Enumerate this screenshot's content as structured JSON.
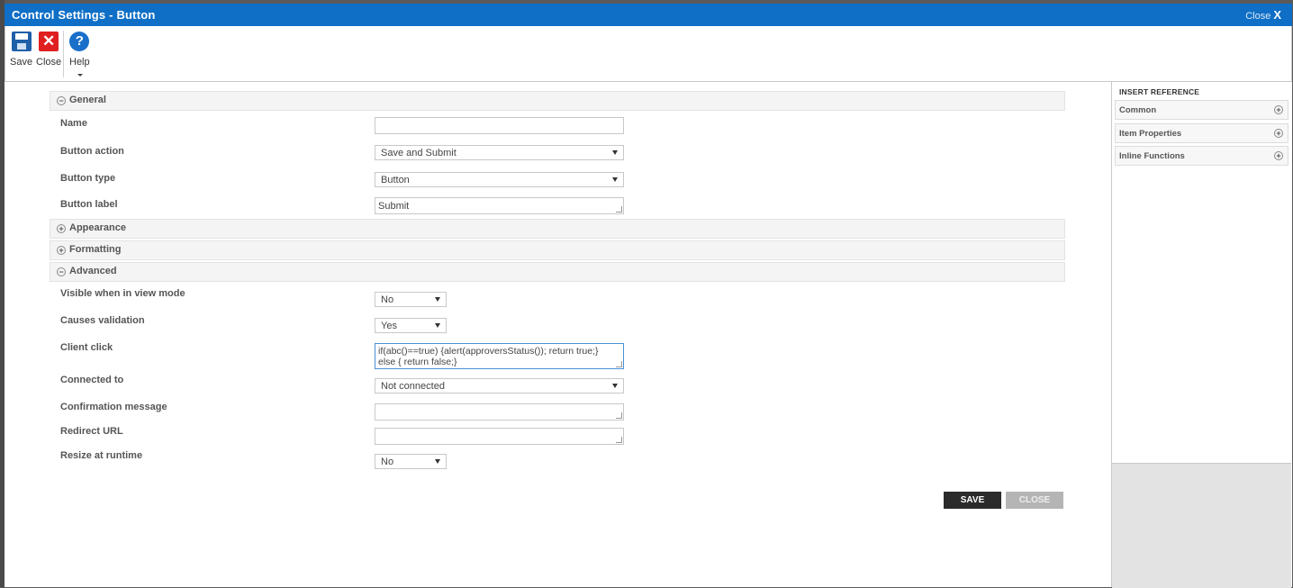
{
  "window": {
    "title": "Control Settings - Button",
    "close_label": "Close",
    "close_glyph": "X"
  },
  "ribbon": {
    "save_label": "Save",
    "close_label": "Close",
    "help_label": "Help",
    "close_glyph": "✕",
    "help_glyph": "?"
  },
  "sections": {
    "general": {
      "label": "General",
      "toggle": "−",
      "expanded": true
    },
    "appearance": {
      "label": "Appearance",
      "toggle": "+",
      "expanded": false
    },
    "formatting": {
      "label": "Formatting",
      "toggle": "+",
      "expanded": false
    },
    "advanced": {
      "label": "Advanced",
      "toggle": "−",
      "expanded": true
    }
  },
  "general": {
    "name": {
      "label": "Name",
      "value": ""
    },
    "button_action": {
      "label": "Button action",
      "value": "Save and Submit"
    },
    "button_type": {
      "label": "Button type",
      "value": "Button"
    },
    "button_label": {
      "label": "Button label",
      "value": "Submit"
    }
  },
  "advanced": {
    "visible_view_mode": {
      "label": "Visible when in view mode",
      "value": "No"
    },
    "causes_validation": {
      "label": "Causes validation",
      "value": "Yes"
    },
    "client_click": {
      "label": "Client click",
      "value": "if(abc()==true) {alert(approversStatus()); return true;} else { return false;}"
    },
    "connected_to": {
      "label": "Connected to",
      "value": "Not connected"
    },
    "confirmation_message": {
      "label": "Confirmation message",
      "value": ""
    },
    "redirect_url": {
      "label": "Redirect URL",
      "value": ""
    },
    "resize_runtime": {
      "label": "Resize at runtime",
      "value": "No"
    }
  },
  "footer": {
    "save_label": "SAVE",
    "close_label": "CLOSE"
  },
  "insert_reference": {
    "title": "INSERT REFERENCE",
    "items": [
      {
        "label": "Common",
        "toggle": "+"
      },
      {
        "label": "Item Properties",
        "toggle": "+"
      },
      {
        "label": "Inline Functions",
        "toggle": "+"
      }
    ]
  },
  "colors": {
    "titlebar": "#0f6fc6",
    "save_button": "#2b2b2b",
    "close_button": "#b5b5b5"
  }
}
